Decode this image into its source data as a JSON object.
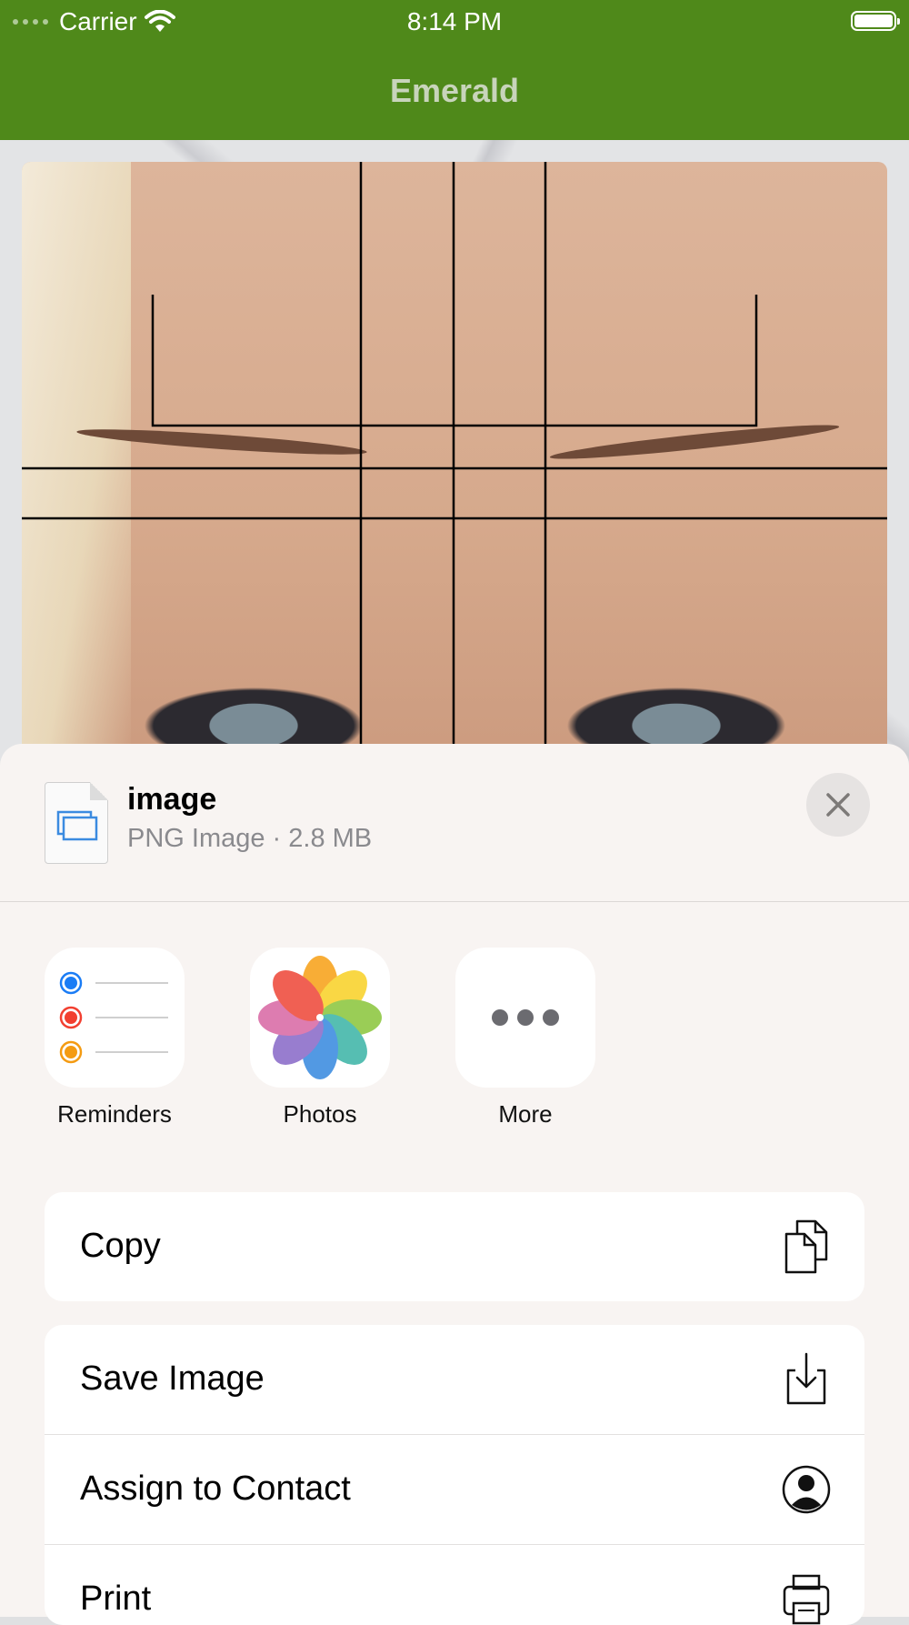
{
  "status_bar": {
    "carrier": "Carrier",
    "time": "8:14 PM"
  },
  "nav": {
    "title": "Emerald"
  },
  "share_sheet": {
    "file_name": "image",
    "file_meta": "PNG Image · 2.8 MB",
    "apps": [
      {
        "label": "Reminders",
        "icon": "reminders-icon"
      },
      {
        "label": "Photos",
        "icon": "photos-icon"
      },
      {
        "label": "More",
        "icon": "more-icon"
      }
    ],
    "actions_primary": [
      {
        "label": "Copy",
        "icon": "copy-icon"
      }
    ],
    "actions_secondary": [
      {
        "label": "Save Image",
        "icon": "save-image-icon"
      },
      {
        "label": "Assign to Contact",
        "icon": "contact-icon"
      },
      {
        "label": "Print",
        "icon": "print-icon"
      }
    ]
  },
  "colors": {
    "nav_green": "#4f891a",
    "sheet_bg": "#f8f4f2"
  }
}
